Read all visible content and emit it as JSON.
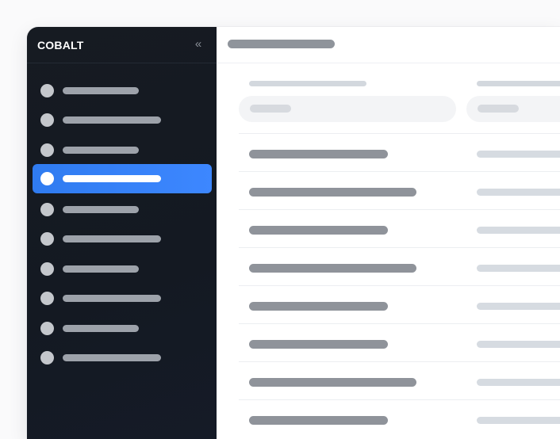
{
  "sidebar": {
    "brand": "COBALT",
    "collapse_glyph": "«",
    "collapse_icon": "double-chevron-left-icon",
    "active_index": 3,
    "items": [
      {
        "icon": "circle-icon"
      },
      {
        "icon": "circle-icon"
      },
      {
        "icon": "circle-icon"
      },
      {
        "icon": "circle-icon"
      },
      {
        "icon": "circle-icon"
      },
      {
        "icon": "circle-icon"
      },
      {
        "icon": "circle-icon"
      },
      {
        "icon": "circle-icon"
      },
      {
        "icon": "circle-icon"
      },
      {
        "icon": "circle-icon"
      }
    ]
  },
  "colors": {
    "sidebar_bg": "#151a22",
    "accent": "#3385f8",
    "placeholder_dark": "#8f949b",
    "placeholder_light": "#d6dbe1"
  }
}
